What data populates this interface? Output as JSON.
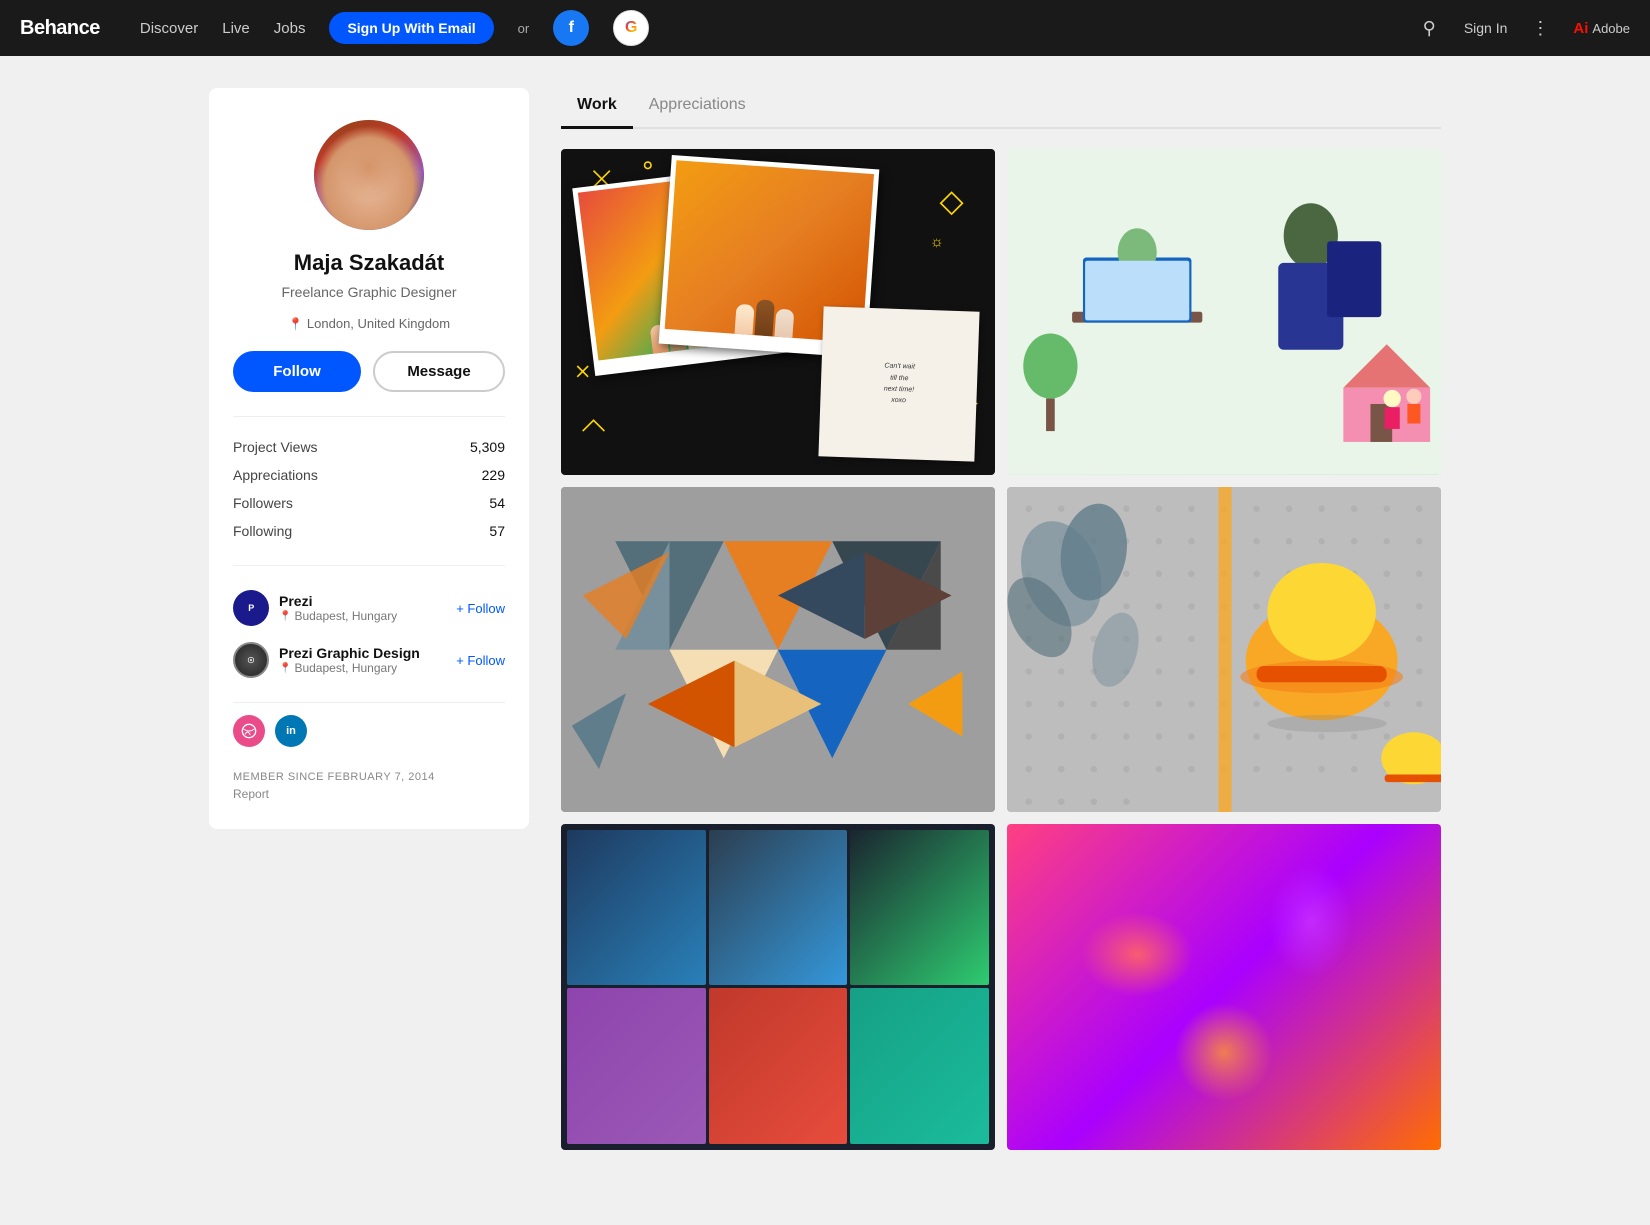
{
  "nav": {
    "logo": "Behance",
    "links": [
      "Discover",
      "Live",
      "Jobs"
    ],
    "signup_btn": "Sign Up With Email",
    "or_text": "or",
    "sign_in": "Sign In",
    "adobe_text": "Adobe"
  },
  "sidebar": {
    "profile_name": "Maja Szakadát",
    "profile_title": "Freelance Graphic Designer",
    "location": "London, United Kingdom",
    "follow_btn": "Follow",
    "message_btn": "Message",
    "stats": [
      {
        "label": "Project Views",
        "value": "5,309"
      },
      {
        "label": "Appreciations",
        "value": "229"
      },
      {
        "label": "Followers",
        "value": "54"
      },
      {
        "label": "Following",
        "value": "57"
      }
    ],
    "affiliations": [
      {
        "name": "Prezi",
        "location": "Budapest, Hungary",
        "follow": "+ Follow",
        "logo": "Prezi"
      },
      {
        "name": "Prezi Graphic Design",
        "location": "Budapest, Hungary",
        "follow": "+ Follow",
        "logo": "PGD"
      }
    ],
    "member_since": "MEMBER SINCE FEBRUARY 7, 2014",
    "report": "Report"
  },
  "tabs": [
    {
      "label": "Work",
      "active": true
    },
    {
      "label": "Appreciations",
      "active": false
    }
  ],
  "projects": [
    {
      "id": 1,
      "type": "polaroid",
      "alt": "Can't wait till the next time polaroid collage"
    },
    {
      "id": 2,
      "type": "illustration",
      "alt": "People working illustration"
    },
    {
      "id": 3,
      "type": "triangles",
      "alt": "Geometric triangles paper art"
    },
    {
      "id": 4,
      "type": "helmet",
      "alt": "Yellow helmet on pegboard"
    },
    {
      "id": 5,
      "type": "slides",
      "alt": "Presentation slides"
    },
    {
      "id": 6,
      "type": "abstract",
      "alt": "Colorful abstract art"
    }
  ]
}
